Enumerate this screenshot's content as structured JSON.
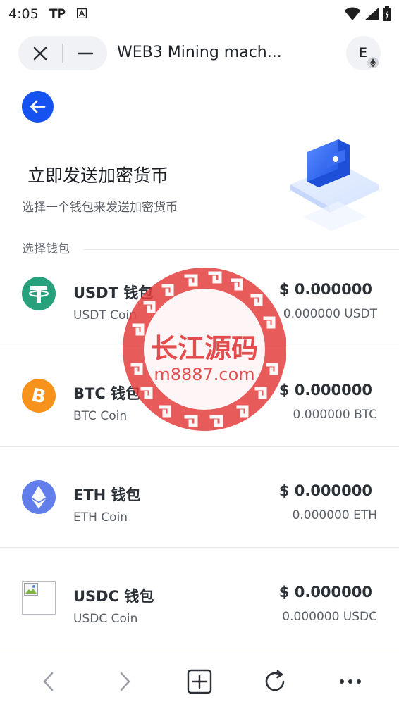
{
  "status_bar": {
    "time": "4:05",
    "app_badge": "TP"
  },
  "browser": {
    "page_title": "WEB3 Mining mach...",
    "avatar_letter": "E"
  },
  "page": {
    "heading": "立即发送加密货币",
    "subheading": "选择一个钱包来发送加密货币",
    "section_label": "选择钱包"
  },
  "wallets": [
    {
      "name": "USDT 钱包",
      "sub": "USDT Coin",
      "fiat": "$ 0.000000",
      "amount": "0.000000 USDT",
      "icon": "usdt-icon"
    },
    {
      "name": "BTC 钱包",
      "sub": "BTC Coin",
      "fiat": "$ 0.000000",
      "amount": "0.000000 BTC",
      "icon": "btc-icon"
    },
    {
      "name": "ETH 钱包",
      "sub": "ETH Coin",
      "fiat": "$ 0.000000",
      "amount": "0.000000 ETH",
      "icon": "eth-icon"
    },
    {
      "name": "USDC 钱包",
      "sub": "USDC Coin",
      "fiat": "$ 0.000000",
      "amount": "0.000000 USDC",
      "icon": "broken-image-icon"
    }
  ],
  "watermark": {
    "title": "长江源码",
    "url": "m8887.com"
  },
  "colors": {
    "accent": "#1652f0",
    "usdt": "#26a17b",
    "btc": "#f7931a",
    "eth": "#627eea",
    "watermark": "#e23a3a"
  },
  "toolbar_icons": [
    "back-icon",
    "forward-icon",
    "new-tab-icon",
    "reload-icon",
    "more-icon"
  ]
}
